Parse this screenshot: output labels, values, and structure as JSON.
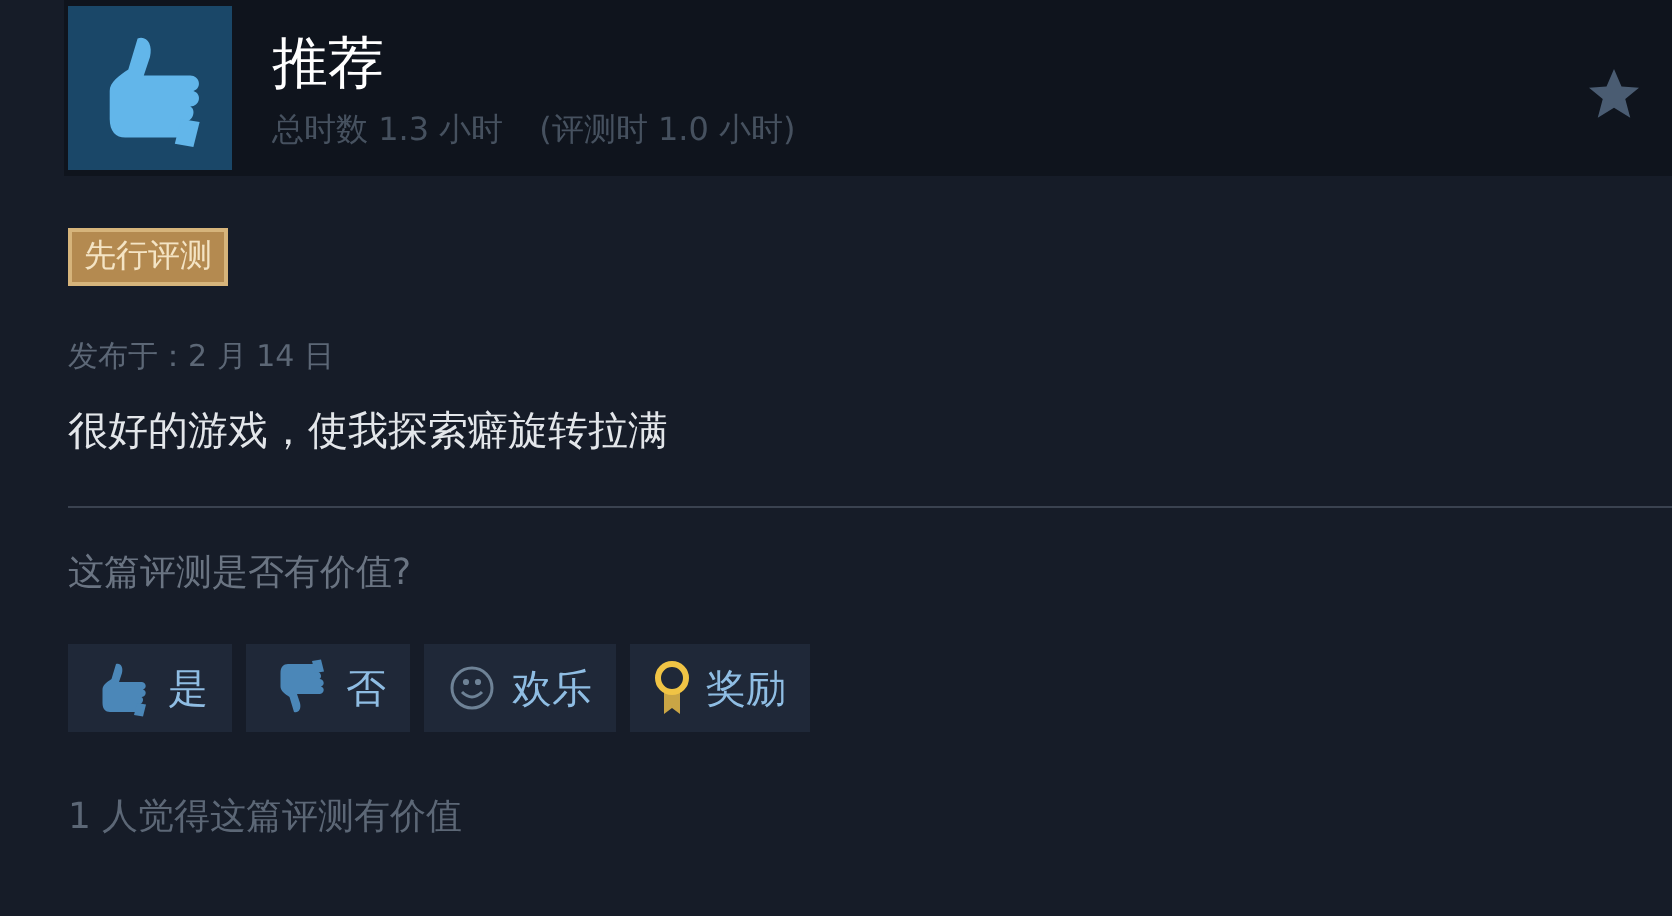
{
  "header": {
    "title": "推荐",
    "playtime": "总时数 1.3 小时",
    "review_time": "(评测时 1.0 小时)"
  },
  "badge": "先行评测",
  "posted": "发布于：2 月 14 日",
  "review_text": "很好的游戏，使我探索癖旋转拉满",
  "question": "这篇评测是否有价值?",
  "buttons": [
    {
      "kind": "yes",
      "label": "是"
    },
    {
      "kind": "no",
      "label": "否"
    },
    {
      "kind": "funny",
      "label": "欢乐"
    },
    {
      "kind": "award",
      "label": "奖励"
    }
  ],
  "helpful_count": "1 人觉得这篇评测有价值"
}
